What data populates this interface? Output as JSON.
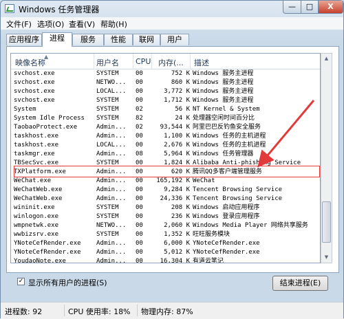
{
  "window": {
    "title": "Windows 任务管理器",
    "min_label": "—",
    "max_label": "□",
    "close_label": "X"
  },
  "menu": [
    "文件(F)",
    "选项(O)",
    "查看(V)",
    "帮助(H)"
  ],
  "tabs": [
    "应用程序",
    "进程",
    "服务",
    "性能",
    "联网",
    "用户"
  ],
  "active_tab": "进程",
  "columns": [
    "映像名称",
    "用户名",
    "CPU",
    "内存(...",
    "描述"
  ],
  "rows": [
    [
      "svchost.exe",
      "SYSTEM",
      "00",
      "752 K",
      "Windows 服务主进程"
    ],
    [
      "svchost.exe",
      "NETWO...",
      "00",
      "860 K",
      "Windows 服务主进程"
    ],
    [
      "svchost.exe",
      "LOCAL...",
      "00",
      "3,772 K",
      "Windows 服务主进程"
    ],
    [
      "svchost.exe",
      "SYSTEM",
      "00",
      "1,712 K",
      "Windows 服务主进程"
    ],
    [
      "System",
      "SYSTEM",
      "02",
      "56 K",
      "NT Kernel & System"
    ],
    [
      "System Idle Process",
      "SYSTEM",
      "82",
      "24 K",
      "处理器空闲时间百分比"
    ],
    [
      "TaobaoProtect.exe",
      "Admin...",
      "02",
      "93,544 K",
      "阿里巴巴反钓鱼安全服务"
    ],
    [
      "taskhost.exe",
      "Admin...",
      "00",
      "1,100 K",
      "Windows 任务的主机进程"
    ],
    [
      "taskhost.exe",
      "LOCAL...",
      "00",
      "2,676 K",
      "Windows 任务的主机进程"
    ],
    [
      "taskmgr.exe",
      "Admin...",
      "08",
      "5,964 K",
      "Windows 任务管理器"
    ],
    [
      "TBSecSvc.exe",
      "SYSTEM",
      "00",
      "1,824 K",
      "Alibaba Anti-phishing Service"
    ],
    [
      "TXPlatform.exe",
      "Admin...",
      "00",
      "620 K",
      "腾讯QQ多客户端管理服务"
    ],
    [
      "WeChat.exe",
      "Admin...",
      "00",
      "165,192 K",
      "WeChat"
    ],
    [
      "WeChatWeb.exe",
      "Admin...",
      "00",
      "9,284 K",
      "Tencent Browsing Service"
    ],
    [
      "WeChatWeb.exe",
      "Admin...",
      "00",
      "24,336 K",
      "Tencent Browsing Service"
    ],
    [
      "wininit.exe",
      "SYSTEM",
      "00",
      "208 K",
      "Windows 启动应用程序"
    ],
    [
      "winlogon.exe",
      "SYSTEM",
      "00",
      "236 K",
      "Windows 登录应用程序"
    ],
    [
      "wmpnetwk.exe",
      "NETWO...",
      "00",
      "2,060 K",
      "Windows Media Player 网络共享服务"
    ],
    [
      "wwbizsrv.exe",
      "SYSTEM",
      "00",
      "1,352 K",
      "旺旺服务模块"
    ],
    [
      "YNoteCefRender.exe",
      "Admin...",
      "00",
      "6,000 K",
      "YNoteCefRender.exe"
    ],
    [
      "YNoteCefRender.exe",
      "Admin...",
      "00",
      "5,012 K",
      "YNoteCefRender.exe"
    ],
    [
      "YoudaoNote.exe",
      "Admin...",
      "00",
      "16,304 K",
      "有道云笔记"
    ]
  ],
  "highlighted_row": "TXPlatform.exe",
  "show_all_label": "显示所有用户的进程(S)",
  "show_all_checked": true,
  "end_process_label": "结束进程(E)",
  "status": {
    "processes": "进程数: 92",
    "cpu": "CPU 使用率: 18%",
    "memory": "物理内存: 87%"
  },
  "colors": {
    "highlight_border": "#e23a3a"
  }
}
